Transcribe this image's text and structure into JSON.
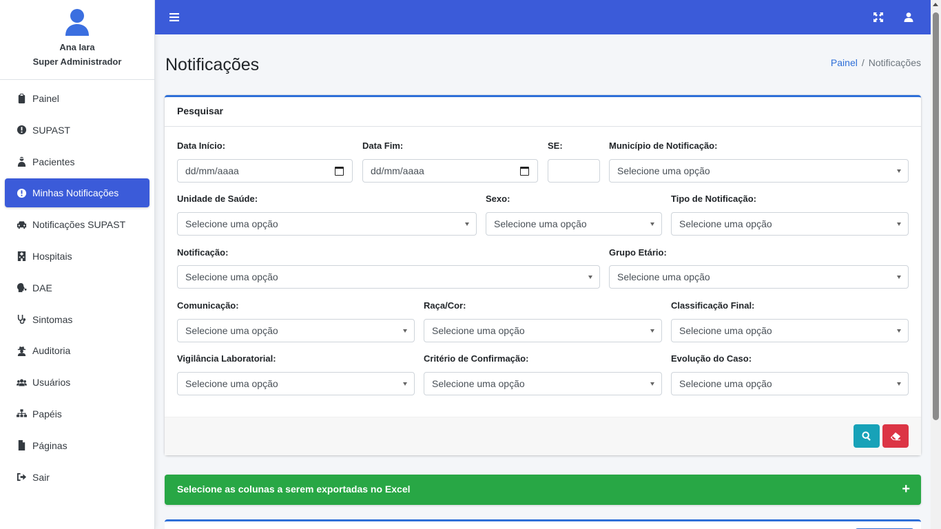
{
  "user": {
    "name": "Ana Iara",
    "role": "Super Administrador"
  },
  "sidebar": {
    "items": [
      {
        "label": "Painel",
        "icon": "clipboard-icon"
      },
      {
        "label": "SUPAST",
        "icon": "exclamation-circle-icon"
      },
      {
        "label": "Pacientes",
        "icon": "user-injured-icon"
      },
      {
        "label": "Minhas Notificações",
        "icon": "exclamation-circle-icon",
        "active": true
      },
      {
        "label": "Notificações SUPAST",
        "icon": "car-icon"
      },
      {
        "label": "Hospitais",
        "icon": "hospital-icon"
      },
      {
        "label": "DAE",
        "icon": "head-virus-icon"
      },
      {
        "label": "Sintomas",
        "icon": "stethoscope-icon"
      },
      {
        "label": "Auditoria",
        "icon": "user-secret-icon"
      },
      {
        "label": "Usuários",
        "icon": "users-icon"
      },
      {
        "label": "Papéis",
        "icon": "sitemap-icon"
      },
      {
        "label": "Páginas",
        "icon": "file-icon"
      },
      {
        "label": "Sair",
        "icon": "sign-out-icon"
      }
    ]
  },
  "page": {
    "title": "Notificações",
    "breadcrumb": {
      "home": "Painel",
      "separator": "/",
      "current": "Notificações"
    }
  },
  "search": {
    "title": "Pesquisar",
    "fields": {
      "data_inicio": {
        "label": "Data Início:",
        "value": "dd/mm/aaaa"
      },
      "data_fim": {
        "label": "Data Fim:",
        "value": "dd/mm/aaaa"
      },
      "se": {
        "label": "SE:",
        "value": ""
      },
      "municipio": {
        "label": "Município de Notificação:",
        "value": "Selecione uma opção"
      },
      "unidade": {
        "label": "Unidade de Saúde:",
        "value": "Selecione uma opção"
      },
      "sexo": {
        "label": "Sexo:",
        "value": "Selecione uma opção"
      },
      "tipo_notificacao": {
        "label": "Tipo de Notificação:",
        "value": "Selecione uma opção"
      },
      "notificacao": {
        "label": "Notificação:",
        "value": "Selecione uma opção"
      },
      "grupo_etario": {
        "label": "Grupo Etário:",
        "value": "Selecione uma opção"
      },
      "comunicacao": {
        "label": "Comunicação:",
        "value": "Selecione uma opção"
      },
      "raca_cor": {
        "label": "Raça/Cor:",
        "value": "Selecione uma opção"
      },
      "classificacao": {
        "label": "Classificação Final:",
        "value": "Selecione uma opção"
      },
      "vigilancia": {
        "label": "Vigilância Laboratorial:",
        "value": "Selecione uma opção"
      },
      "criterio": {
        "label": "Critério de Confirmação:",
        "value": "Selecione uma opção"
      },
      "evolucao": {
        "label": "Evolução do Caso:",
        "value": "Selecione uma opção"
      }
    }
  },
  "export": {
    "label": "Selecione as colunas a serem exportadas no Excel",
    "toggle": "+"
  },
  "colors": {
    "primary": "#3b5bd9",
    "info": "#17a2b8",
    "danger": "#dc3545",
    "success": "#28a745"
  }
}
